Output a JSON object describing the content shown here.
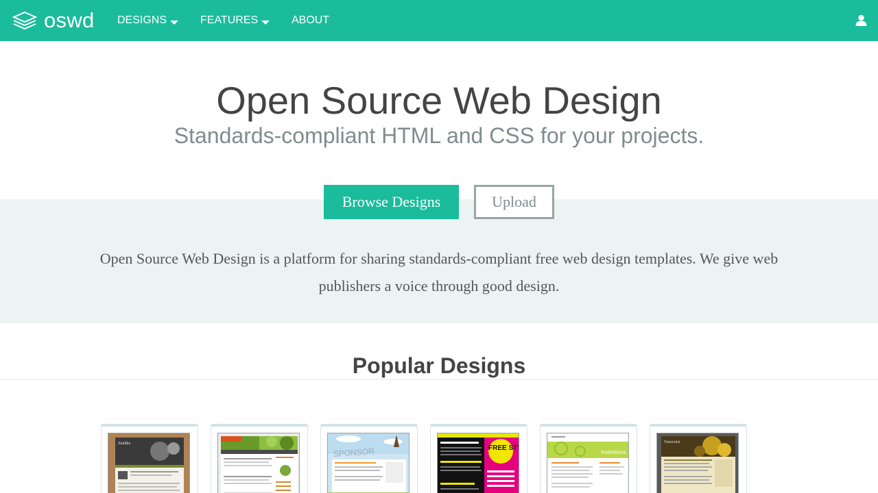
{
  "nav": {
    "brand": "oswd",
    "items": [
      {
        "label": "DESIGNS",
        "has_dropdown": true
      },
      {
        "label": "FEATURES",
        "has_dropdown": true
      },
      {
        "label": "ABOUT",
        "has_dropdown": false
      }
    ],
    "user_icon": "user-icon"
  },
  "hero": {
    "title": "Open Source Web Design",
    "subtitle": "Standards-compliant HTML and CSS for your projects.",
    "browse_label": "Browse Designs",
    "upload_label": "Upload"
  },
  "intro": {
    "text": "Open Source Web Design is a platform for sharing standards-compliant free web design templates. We give web publishers a voice through good design."
  },
  "popular": {
    "title": "Popular Designs",
    "designs": [
      {
        "thumb_text": "Zenlike"
      },
      {
        "thumb_text": ""
      },
      {
        "thumb_text": "SPONSOR"
      },
      {
        "thumb_text": "FREE STYLE"
      },
      {
        "thumb_text": "Inventions"
      },
      {
        "thumb_text": "Naturalist"
      }
    ]
  },
  "colors": {
    "brand": "#1abc9c",
    "band": "#ecf4f3",
    "muted": "#7f8c8d",
    "text": "#444444"
  }
}
